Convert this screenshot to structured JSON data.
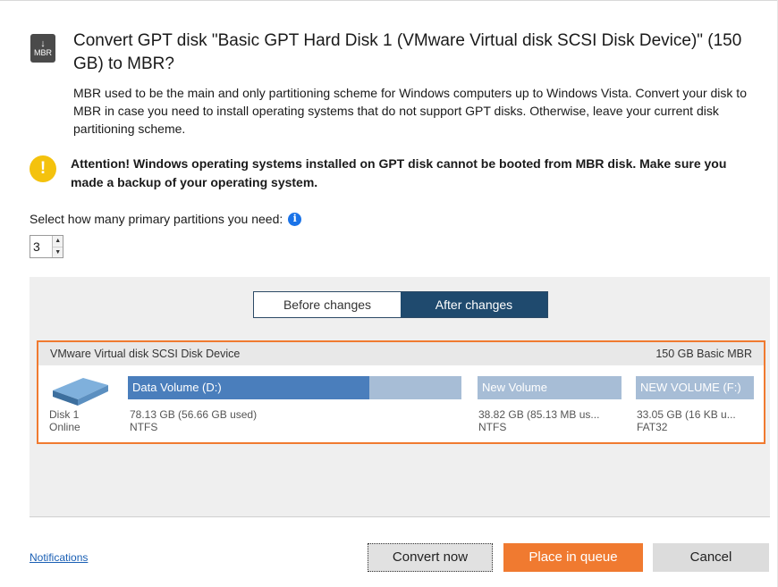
{
  "dialog": {
    "icon_label": "MBR",
    "title": "Convert GPT disk \"Basic GPT Hard Disk 1 (VMware Virtual disk SCSI Disk Device)\" (150 GB) to MBR?",
    "description": "MBR used to be the main and only partitioning scheme for Windows computers up to Windows Vista. Convert your disk to MBR in case you need to install operating systems that do not support GPT disks. Otherwise, leave your current disk partitioning scheme.",
    "warning": "Attention! Windows operating systems installed on GPT disk cannot be booted from MBR disk. Make sure you made a backup of your operating system."
  },
  "partitions_selector": {
    "label": "Select how many primary partitions you need:",
    "value": "3"
  },
  "tabs": [
    {
      "label": "Before changes",
      "active": false
    },
    {
      "label": "After changes",
      "active": true
    }
  ],
  "disk": {
    "name": "VMware Virtual disk SCSI Disk Device",
    "capacity": "150 GB Basic MBR",
    "label": "Disk 1",
    "status": "Online",
    "partitions": [
      {
        "name": "Data Volume (D:)",
        "size": "78.13 GB (56.66 GB used)",
        "fs": "NTFS",
        "used_fraction": 0.725
      },
      {
        "name": "New Volume",
        "size": "38.82 GB (85.13 MB us...",
        "fs": "NTFS",
        "used_fraction": 0.0
      },
      {
        "name": "NEW VOLUME (F:)",
        "size": "33.05 GB (16 KB u...",
        "fs": "FAT32",
        "used_fraction": 0.0
      }
    ]
  },
  "footer": {
    "notifications_link": "Notifications",
    "convert_now": "Convert now",
    "place_in_queue": "Place in queue",
    "cancel": "Cancel"
  },
  "colors": {
    "accent_orange": "#f07a30",
    "active_tab": "#1f4a6e",
    "partition_free": "#a7bdd6",
    "partition_used": "#4a7ebc",
    "warning_yellow": "#f4c20d",
    "info_blue": "#1a73e8"
  }
}
